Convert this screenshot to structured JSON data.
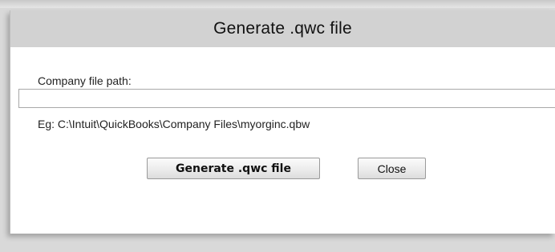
{
  "dialog": {
    "title": "Generate .qwc file",
    "field_label": "Company file path:",
    "path_value": "",
    "example_text": "Eg: C:\\Intuit\\QuickBooks\\Company Files\\myorginc.qbw",
    "generate_label": "Generate .qwc file",
    "close_label": "Close"
  }
}
